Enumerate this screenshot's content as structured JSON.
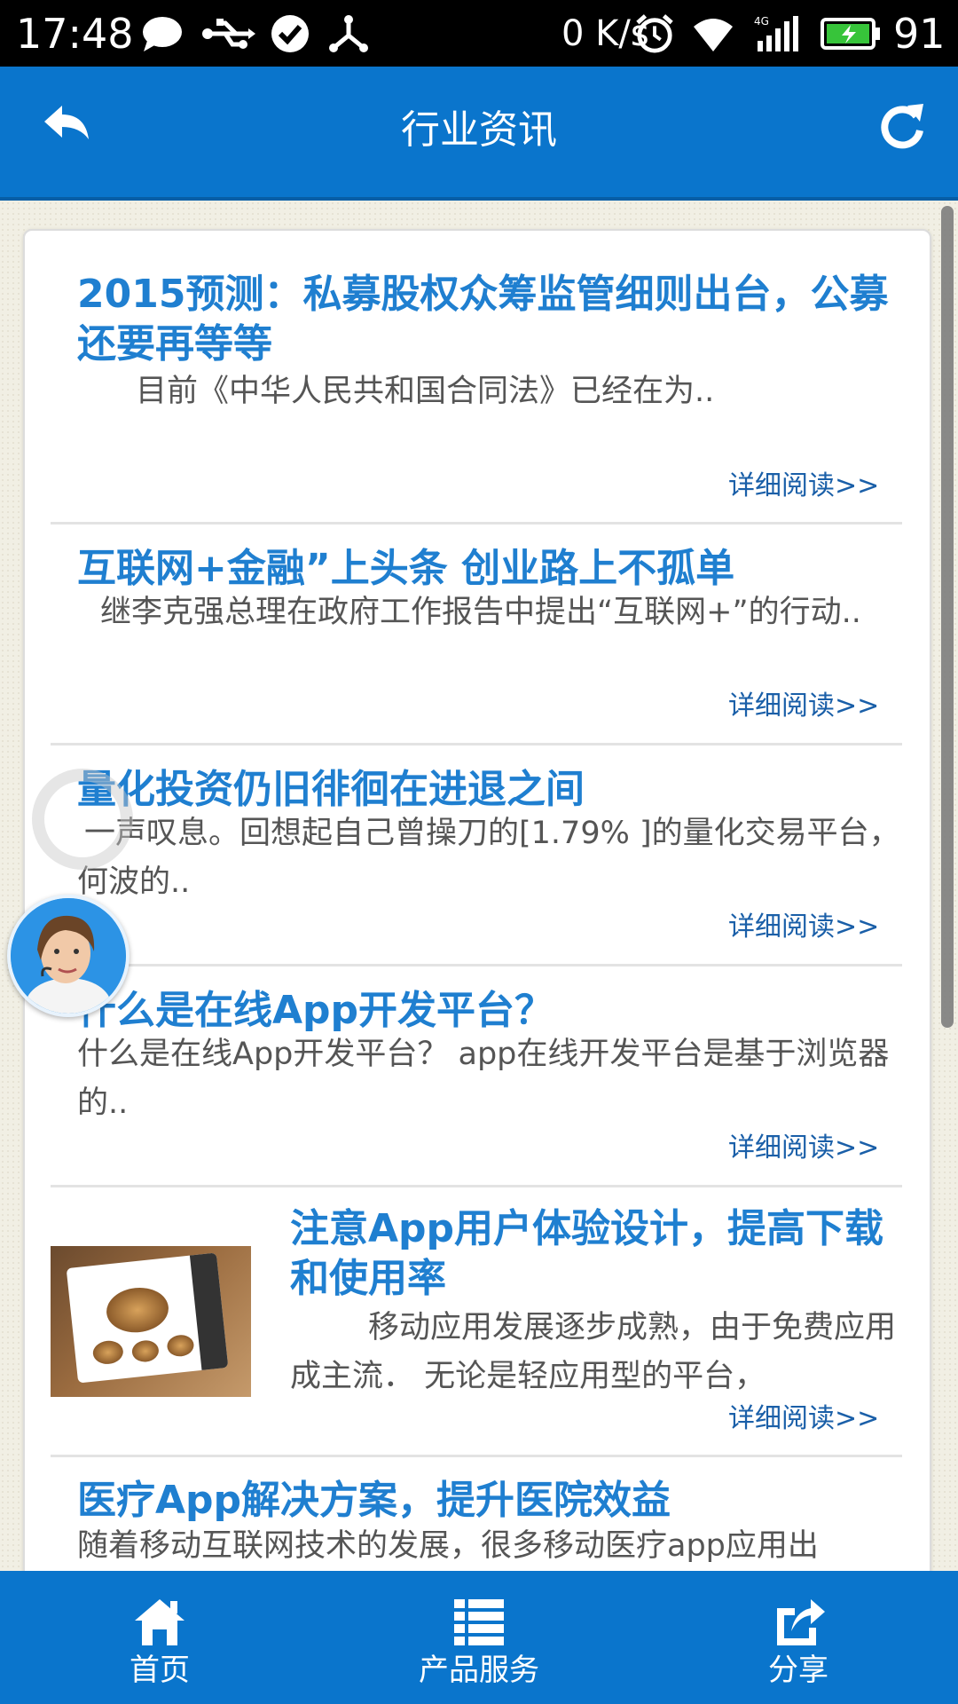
{
  "status_bar": {
    "time": "17:48",
    "speed": "0 K/s",
    "battery": "91"
  },
  "header": {
    "title": "行业资讯"
  },
  "articles": [
    {
      "title": "2015预测：私募股权众筹监管细则出台，公募还要再等等",
      "summary": "目前《中华人民共和国合同法》已经在为..",
      "more": "详细阅读>>"
    },
    {
      "title": "互联网+金融”上头条 创业路上不孤单",
      "summary": "继李克强总理在政府工作报告中提出“互联网+”的行动..",
      "more": "详细阅读>>"
    },
    {
      "title": "量化投资仍旧徘徊在进退之间",
      "summary": "一声叹息。回想起自己曾操刀的[1.79% ]的量化交易平台，何波的..",
      "more": "详细阅读>>"
    },
    {
      "title": "什么是在线App开发平台？",
      "summary": "什么是在线App开发平台？ app在线开发平台是基于浏览器的..",
      "more": "详细阅读>>"
    },
    {
      "title": "注意App用户体验设计，提高下载和使用率",
      "summary": "移动应用发展逐步成熟，由于免费应用成主流． 无论是轻应用型的平台，",
      "more": "详细阅读>>"
    },
    {
      "title": "医疗App解决方案，提升医院效益",
      "summary": "随着移动互联网技术的发展，很多移动医疗app应用出"
    }
  ],
  "bottom_nav": {
    "home": "首页",
    "products": "产品服务",
    "share": "分享"
  },
  "colors": {
    "primary": "#0a75cc",
    "title_blue": "#1f7fd0",
    "link_blue": "#1a5fa8"
  }
}
